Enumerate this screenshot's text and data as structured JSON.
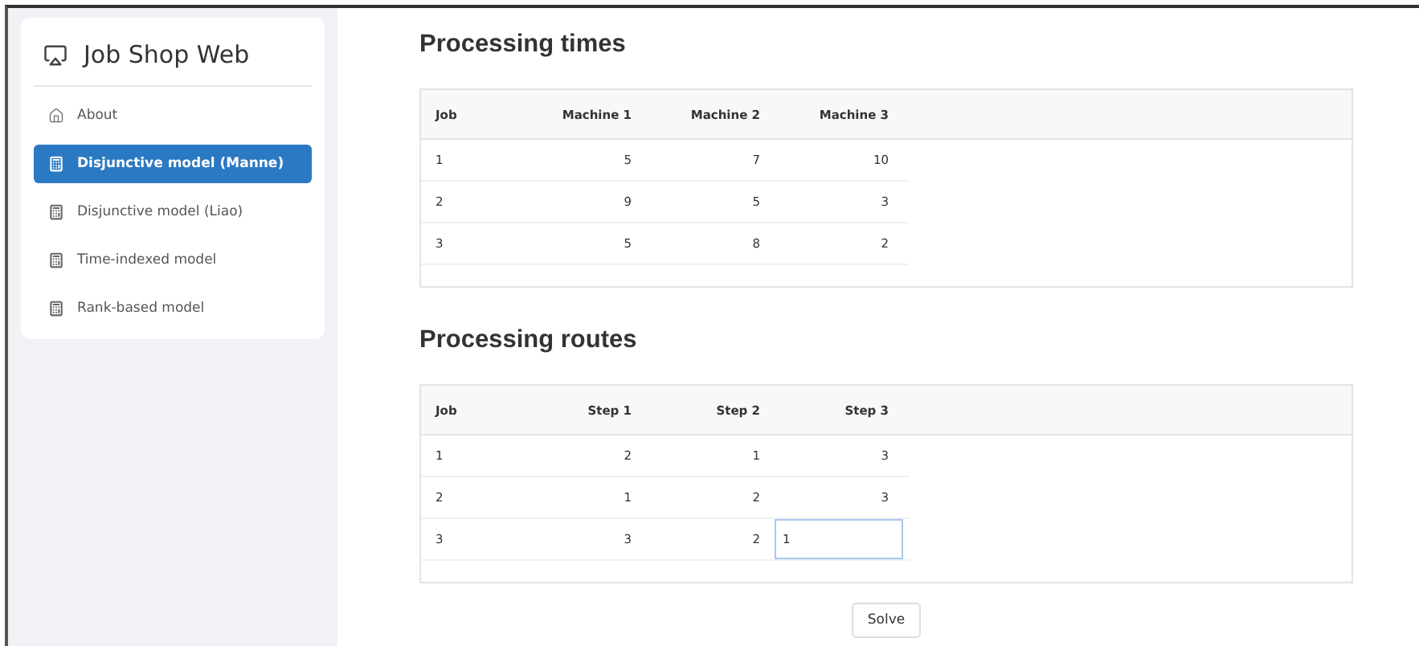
{
  "sidebar": {
    "title": "Job Shop Web",
    "items": [
      {
        "label": "About",
        "selected": false
      },
      {
        "label": "Disjunctive model (Manne)",
        "selected": true
      },
      {
        "label": "Disjunctive model (Liao)",
        "selected": false
      },
      {
        "label": "Time-indexed model",
        "selected": false
      },
      {
        "label": "Rank-based model",
        "selected": false
      }
    ]
  },
  "sections": [
    {
      "title": "Processing times",
      "table": {
        "columns": [
          "Job",
          "Machine 1",
          "Machine 2",
          "Machine 3"
        ],
        "rows": [
          [
            {
              "value": "1",
              "editing": false
            },
            {
              "value": "5",
              "editing": false
            },
            {
              "value": "7",
              "editing": false
            },
            {
              "value": "10",
              "editing": false
            }
          ],
          [
            {
              "value": "2",
              "editing": false
            },
            {
              "value": "9",
              "editing": false
            },
            {
              "value": "5",
              "editing": false
            },
            {
              "value": "3",
              "editing": false
            }
          ],
          [
            {
              "value": "3",
              "editing": false
            },
            {
              "value": "5",
              "editing": false
            },
            {
              "value": "8",
              "editing": false
            },
            {
              "value": "2",
              "editing": false
            }
          ]
        ]
      }
    },
    {
      "title": "Processing routes",
      "table": {
        "columns": [
          "Job",
          "Step 1",
          "Step 2",
          "Step 3"
        ],
        "rows": [
          [
            {
              "value": "1",
              "editing": false
            },
            {
              "value": "2",
              "editing": false
            },
            {
              "value": "1",
              "editing": false
            },
            {
              "value": "3",
              "editing": false
            }
          ],
          [
            {
              "value": "2",
              "editing": false
            },
            {
              "value": "1",
              "editing": false
            },
            {
              "value": "2",
              "editing": false
            },
            {
              "value": "3",
              "editing": false
            }
          ],
          [
            {
              "value": "3",
              "editing": false
            },
            {
              "value": "3",
              "editing": false
            },
            {
              "value": "2",
              "editing": false
            },
            {
              "value": "1",
              "editing": true
            }
          ]
        ]
      }
    }
  ],
  "solve_button": "Solve"
}
